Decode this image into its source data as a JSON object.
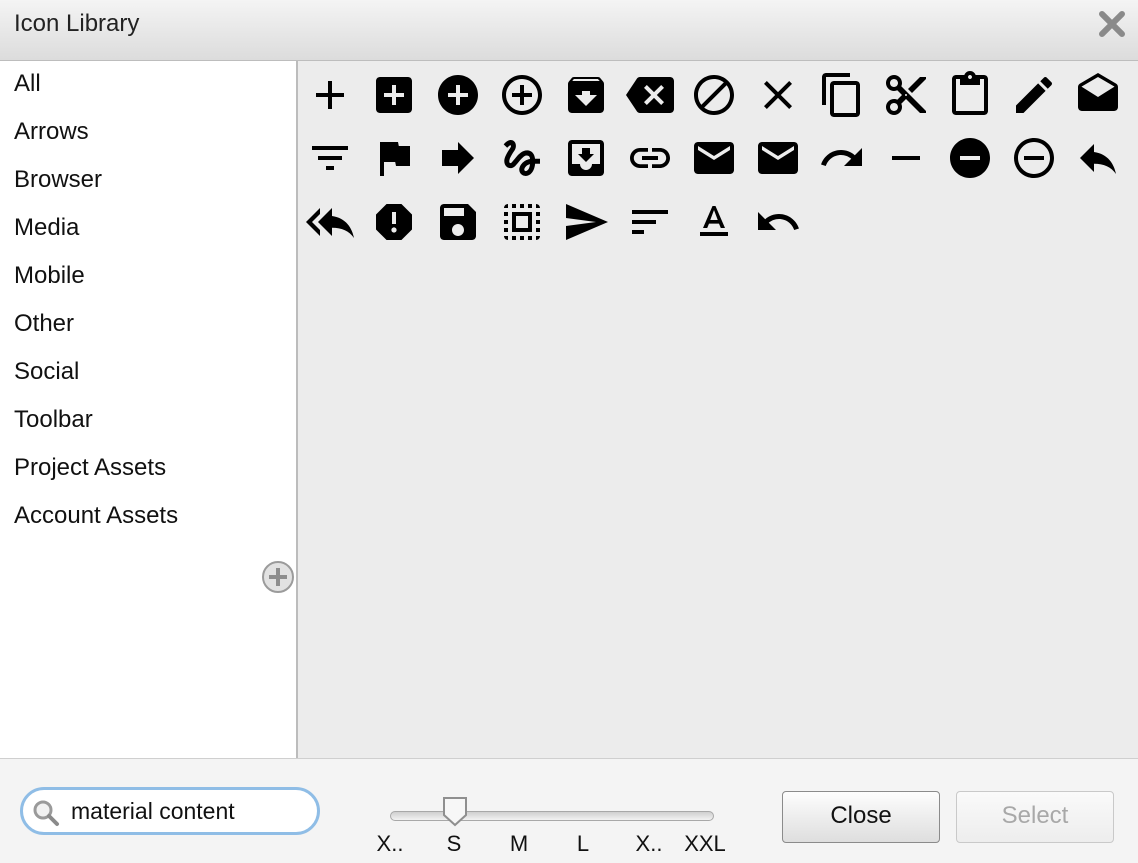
{
  "window": {
    "title": "Icon Library"
  },
  "sidebar": {
    "categories": [
      "All",
      "Arrows",
      "Browser",
      "Media",
      "Mobile",
      "Other",
      "Social",
      "Toolbar",
      "Project Assets",
      "Account Assets"
    ]
  },
  "icons": [
    "add-icon",
    "add-box-icon",
    "add-circle-icon",
    "add-circle-outline-icon",
    "archive-icon",
    "backspace-icon",
    "block-icon",
    "clear-icon",
    "content-copy-icon",
    "content-cut-icon",
    "content-paste-icon",
    "create-icon",
    "drafts-icon",
    "filter-list-icon",
    "flag-icon",
    "forward-icon",
    "gesture-icon",
    "inbox-icon",
    "link-icon",
    "mail-icon",
    "markunread-icon",
    "redo-icon",
    "remove-icon",
    "remove-circle-icon",
    "remove-circle-outline-icon",
    "reply-icon",
    "reply-all-icon",
    "report-icon",
    "save-icon",
    "select-all-icon",
    "send-icon",
    "sort-icon",
    "text-format-icon",
    "undo-icon"
  ],
  "search": {
    "value": "material content"
  },
  "size_slider": {
    "ticks": [
      "X..",
      "S",
      "M",
      "L",
      "X..",
      "XXL"
    ],
    "selected": "S"
  },
  "buttons": {
    "close": "Close",
    "select": "Select"
  }
}
